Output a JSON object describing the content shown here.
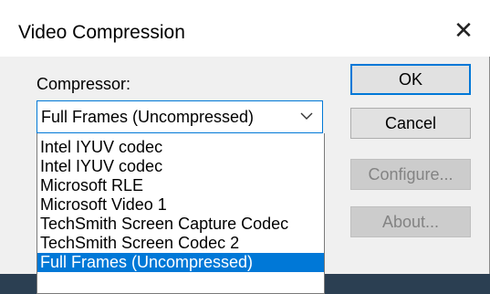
{
  "dialog": {
    "title": "Video Compression",
    "close_glyph": "✕"
  },
  "compressor": {
    "label": "Compressor:",
    "selected": "Full Frames (Uncompressed)",
    "options": [
      "Intel IYUV codec",
      "Intel IYUV codec",
      "Microsoft RLE",
      "Microsoft Video 1",
      "TechSmith Screen Capture Codec",
      "TechSmith Screen Codec 2",
      "Full Frames (Uncompressed)"
    ],
    "highlighted_index": 6
  },
  "buttons": {
    "ok": "OK",
    "cancel": "Cancel",
    "configure": "Configure...",
    "about": "About..."
  },
  "colors": {
    "accent": "#0078d7"
  },
  "icons": {
    "close": "close-icon",
    "dropdown": "chevron-down-icon"
  }
}
